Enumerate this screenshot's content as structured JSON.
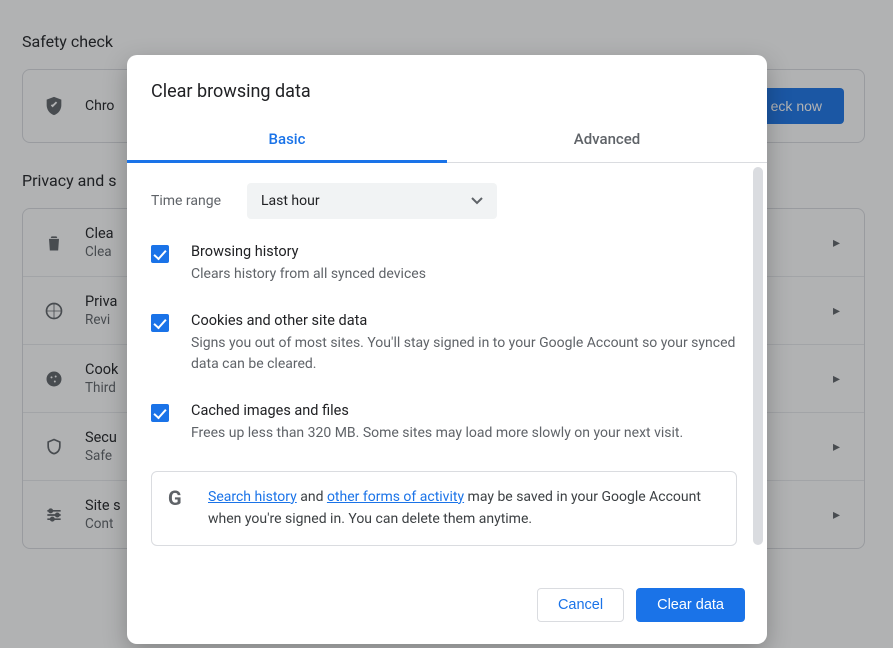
{
  "background": {
    "safety_check": {
      "title": "Safety check",
      "row_label": "Chro",
      "button": "eck now"
    },
    "privacy": {
      "title": "Privacy and s",
      "rows": [
        {
          "title": "Clea",
          "subtitle": "Clea",
          "icon": "trash-icon"
        },
        {
          "title": "Priva",
          "subtitle": "Revi",
          "icon": "compass-icon"
        },
        {
          "title": "Cook",
          "subtitle": "Third",
          "icon": "cookie-icon"
        },
        {
          "title": "Secu",
          "subtitle": "Safe",
          "icon": "shield-icon"
        },
        {
          "title": "Site s",
          "subtitle": "Cont",
          "icon": "sliders-icon"
        }
      ]
    }
  },
  "dialog": {
    "title": "Clear browsing data",
    "tabs": {
      "basic": "Basic",
      "advanced": "Advanced",
      "active": "basic"
    },
    "time_range": {
      "label": "Time range",
      "value": "Last hour"
    },
    "options": [
      {
        "title": "Browsing history",
        "description": "Clears history from all synced devices",
        "checked": true
      },
      {
        "title": "Cookies and other site data",
        "description": "Signs you out of most sites. You'll stay signed in to your Google Account so your synced data can be cleared.",
        "checked": true
      },
      {
        "title": "Cached images and files",
        "description": "Frees up less than 320 MB. Some sites may load more slowly on your next visit.",
        "checked": true
      }
    ],
    "notice": {
      "link1": "Search history",
      "mid1": " and ",
      "link2": "other forms of activity",
      "rest": " may be saved in your Google Account when you're signed in. You can delete them anytime."
    },
    "buttons": {
      "cancel": "Cancel",
      "confirm": "Clear data"
    }
  }
}
